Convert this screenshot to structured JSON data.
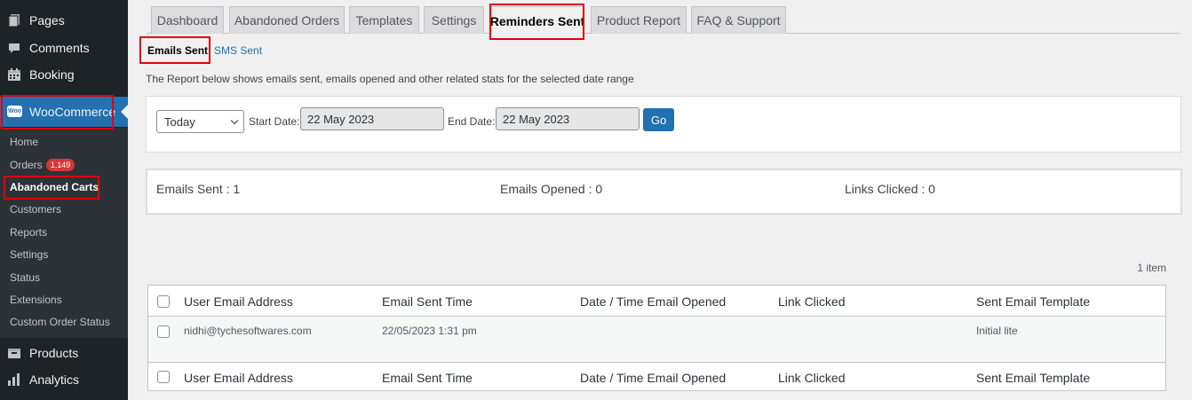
{
  "sidebar": {
    "items": [
      {
        "label": "Pages",
        "icon": "pages-icon"
      },
      {
        "label": "Comments",
        "icon": "comments-icon"
      },
      {
        "label": "Booking",
        "icon": "booking-icon"
      },
      {
        "label": "WooCommerce",
        "icon": "woocommerce-icon"
      },
      {
        "label": "Products",
        "icon": "products-icon"
      },
      {
        "label": "Analytics",
        "icon": "analytics-icon"
      }
    ],
    "woo_icon_text": "Woo",
    "submenu": [
      {
        "label": "Home"
      },
      {
        "label": "Orders",
        "badge": "1,149"
      },
      {
        "label": "Abandoned Carts"
      },
      {
        "label": "Customers"
      },
      {
        "label": "Reports"
      },
      {
        "label": "Settings"
      },
      {
        "label": "Status"
      },
      {
        "label": "Extensions"
      },
      {
        "label": "Custom Order Status"
      }
    ]
  },
  "tabs": [
    {
      "label": "Dashboard"
    },
    {
      "label": "Abandoned Orders"
    },
    {
      "label": "Templates"
    },
    {
      "label": "Settings"
    },
    {
      "label": "Reminders Sent"
    },
    {
      "label": "Product Report"
    },
    {
      "label": "FAQ & Support"
    }
  ],
  "subtabs": {
    "emails": "Emails Sent",
    "separator": "|",
    "sms": "SMS Sent"
  },
  "description": "The Report below shows emails sent, emails opened and other related stats for the selected date range",
  "filter": {
    "range": "Today",
    "start_label": "Start Date:",
    "start_value": "22 May 2023",
    "end_label": "End Date:",
    "end_value": "22 May 2023",
    "go_label": "Go"
  },
  "stats": {
    "sent": "Emails Sent : 1",
    "opened": "Emails Opened : 0",
    "clicked": "Links Clicked : 0"
  },
  "item_count": "1 item",
  "table": {
    "columns": [
      "User Email Address",
      "Email Sent Time",
      "Date / Time Email Opened",
      "Link Clicked",
      "Sent Email Template"
    ],
    "rows": [
      [
        "nidhi@tychesoftwares.com",
        "22/05/2023 1:31 pm",
        "",
        "",
        "Initial lite"
      ]
    ]
  },
  "colors": {
    "sidebar_bg": "#1d2327",
    "accent": "#2271b1",
    "highlight": "#e0000a",
    "badge": "#d63638"
  }
}
